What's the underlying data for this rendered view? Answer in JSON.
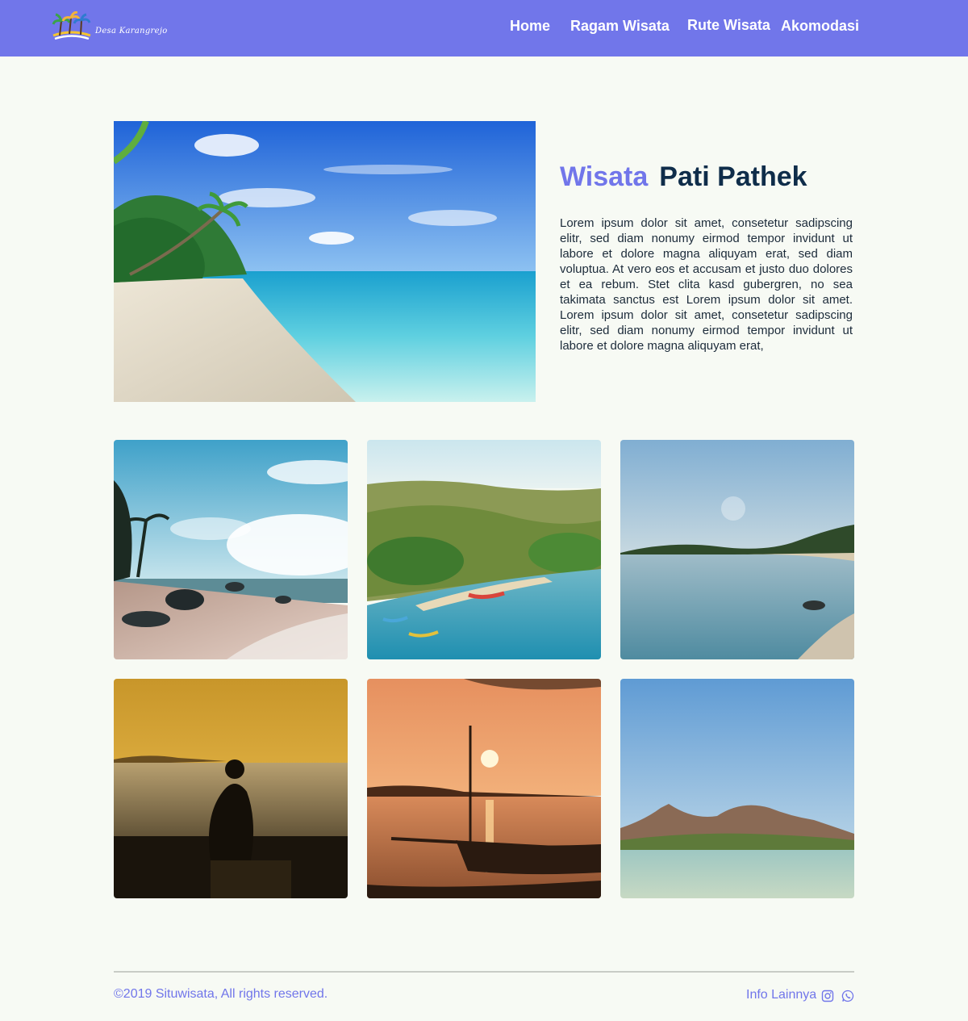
{
  "nav": {
    "logo_text": "Desa Karangrejo",
    "links": [
      "Home",
      "Ragam Wisata",
      "Rute Wisata",
      "Akomodasi"
    ]
  },
  "hero": {
    "title_accent": "Wisata",
    "title_main": "Pati Pathek",
    "paragraph": "Lorem ipsum dolor sit amet, consetetur sadipscing elitr, sed diam nonumy eirmod tempor invidunt ut labore et dolore magna aliquyam erat, sed diam voluptua. At vero eos et accusam et justo duo dolores et ea rebum. Stet clita kasd gubergren, no sea takimata sanctus est Lorem ipsum dolor sit amet. Lorem ipsum dolor sit amet, consetetur sadipscing elitr, sed diam nonumy eirmod tempor invidunt ut labore et dolore magna aliquyam erat,"
  },
  "gallery": {
    "photos": [
      "beach-rocks-photo",
      "boats-bay-photo",
      "calm-coast-photo",
      "sunset-silhouette-photo",
      "sunset-boat-photo",
      "mountain-coast-photo"
    ]
  },
  "footer": {
    "copyright": "©2019 Situwisata, All rights reserved.",
    "info_label": "Info Lainnya",
    "icons": [
      "instagram-icon",
      "whatsapp-icon"
    ]
  },
  "colors": {
    "accent": "#7176ea",
    "heading": "#0f2d4a",
    "background": "#f7faf4"
  }
}
